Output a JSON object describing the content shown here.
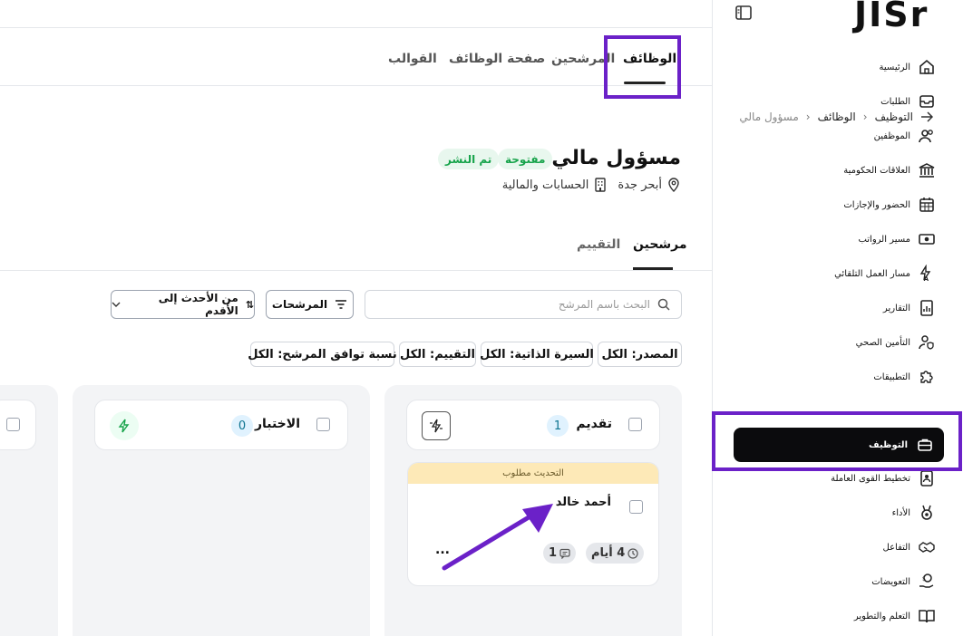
{
  "sidebar": {
    "logo": "JISr",
    "items": [
      {
        "label": "الرئيسية",
        "icon": "home-icon"
      },
      {
        "label": "الطلبات",
        "icon": "inbox-icon"
      },
      {
        "label": "الموظفين",
        "icon": "users-icon"
      },
      {
        "label": "العلاقات الحكومية",
        "icon": "bank-icon"
      },
      {
        "label": "الحضور والإجازات",
        "icon": "calendar-icon"
      },
      {
        "label": "مسير الرواتب",
        "icon": "money-icon"
      },
      {
        "label": "مسار العمل التلقائي",
        "icon": "automation-icon"
      },
      {
        "label": "التقارير",
        "icon": "report-icon"
      },
      {
        "label": "التأمين الصحي",
        "icon": "insurance-icon"
      },
      {
        "label": "التطبيقات",
        "icon": "puzzle-icon"
      }
    ],
    "active_item": {
      "label": "التوظيف",
      "icon": "briefcase-icon"
    },
    "items_after": [
      {
        "label": "تخطيط القوى العاملة",
        "icon": "badge-icon"
      },
      {
        "label": "الأداء",
        "icon": "medal-icon"
      },
      {
        "label": "التفاعل",
        "icon": "handshake-icon"
      },
      {
        "label": "التعويضات",
        "icon": "hand-money-icon"
      },
      {
        "label": "التعلم والتطوير",
        "icon": "book-icon"
      }
    ]
  },
  "main_tabs": [
    "الوظائف",
    "المرشحين",
    "صفحة الوظائف",
    "القوالب"
  ],
  "breadcrumb": [
    "التوظيف",
    "الوظائف",
    "مسؤول مالي"
  ],
  "job": {
    "title": "مسؤول مالي",
    "status_badges": [
      "مفتوحة",
      "تم النشر"
    ],
    "location": "أبحر جدة",
    "department": "الحسابات والمالية"
  },
  "sub_tabs": [
    "مرشحين",
    "التقييم"
  ],
  "search": {
    "placeholder": "البحث باسم المرشح"
  },
  "filters_button": "المرشحات",
  "sort_button": "من الأحدث إلى الأقدم",
  "filter_chips": [
    "المصدر: الكل",
    "السيرة الذاتية: الكل",
    "التقييم: الكل",
    "نسبة توافق المرشح: الكل"
  ],
  "columns": [
    {
      "title": "تقديم",
      "count": "1"
    },
    {
      "title": "الاختبار",
      "count": "0"
    }
  ],
  "candidate_card": {
    "banner": "التحديث مطلوب",
    "name": "أحمد خالد",
    "days": "4 أيام",
    "comments": "1",
    "more": "..."
  },
  "colors": {
    "highlight": "#6b21c8",
    "active_nav": "#0b0b0d",
    "badge_green": "#16a34a"
  }
}
